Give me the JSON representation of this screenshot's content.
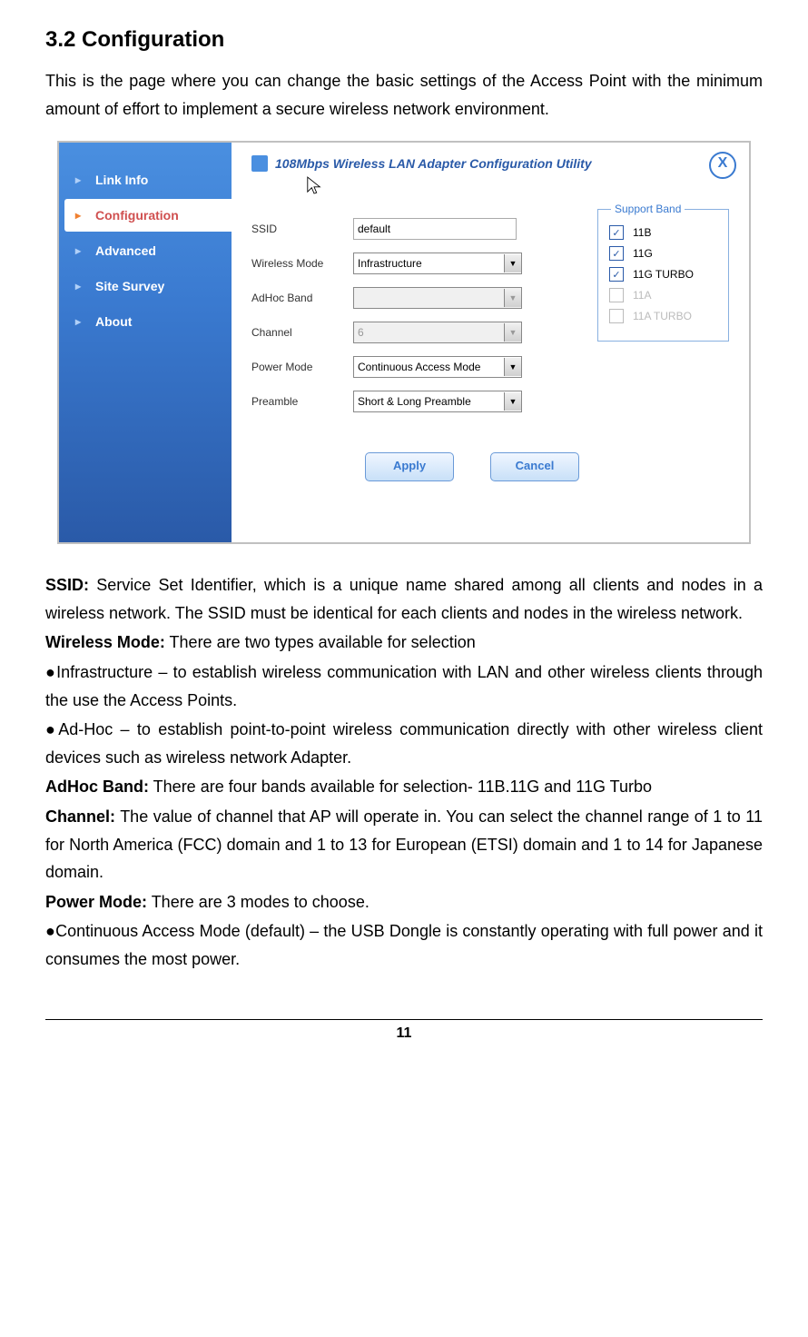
{
  "section": {
    "title": "3.2 Configuration",
    "intro": "This is the page where you can change the basic settings of the Access Point with the minimum amount of effort to implement a secure wireless network environment."
  },
  "app": {
    "title": "108Mbps Wireless LAN Adapter Configuration Utility",
    "sidebar": {
      "items": [
        {
          "label": "Link Info",
          "active": false
        },
        {
          "label": "Configuration",
          "active": true
        },
        {
          "label": "Advanced",
          "active": false
        },
        {
          "label": "Site Survey",
          "active": false
        },
        {
          "label": "About",
          "active": false
        }
      ]
    },
    "form": {
      "ssid_label": "SSID",
      "ssid_value": "default",
      "wmode_label": "Wireless Mode",
      "wmode_value": "Infrastructure",
      "adhoc_label": "AdHoc Band",
      "adhoc_value": "",
      "channel_label": "Channel",
      "channel_value": "6",
      "power_label": "Power Mode",
      "power_value": "Continuous Access Mode",
      "preamble_label": "Preamble",
      "preamble_value": "Short & Long Preamble"
    },
    "support_band": {
      "legend": "Support Band",
      "items": [
        {
          "label": "11B",
          "checked": true,
          "disabled": false
        },
        {
          "label": "11G",
          "checked": true,
          "disabled": false
        },
        {
          "label": "11G TURBO",
          "checked": true,
          "disabled": false
        },
        {
          "label": "11A",
          "checked": false,
          "disabled": true
        },
        {
          "label": "11A TURBO",
          "checked": false,
          "disabled": true
        }
      ]
    },
    "buttons": {
      "apply": "Apply",
      "cancel": "Cancel"
    }
  },
  "descriptions": {
    "ssid_label": "SSID:",
    "ssid_text": " Service Set Identifier, which is a unique name shared among all clients and nodes in a wireless network. The SSID must be identical for each clients and nodes in the wireless network.",
    "wmode_label": "Wireless Mode:",
    "wmode_text": " There are two types available for selection",
    "wmode_b1": "●Infrastructure – to establish wireless communication with LAN and other wireless clients through the use the Access Points.",
    "wmode_b2": "●Ad-Hoc – to establish point-to-point wireless communication directly with other wireless client devices such as wireless network Adapter.",
    "adhoc_label": "AdHoc Band:",
    "adhoc_text": " There are four bands available for selection- 11B.11G and 11G Turbo",
    "channel_label": "Channel:",
    "channel_text": " The value of channel that AP will operate in. You can select the channel range of 1 to 11 for North America (FCC) domain and 1 to 13 for European (ETSI) domain and 1 to 14 for Japanese domain.",
    "power_label": "Power Mode:",
    "power_text": " There are 3 modes to choose.",
    "power_b1": "●Continuous Access Mode (default) – the USB Dongle is constantly operating with full power and it consumes the most power."
  },
  "page_number": "11"
}
